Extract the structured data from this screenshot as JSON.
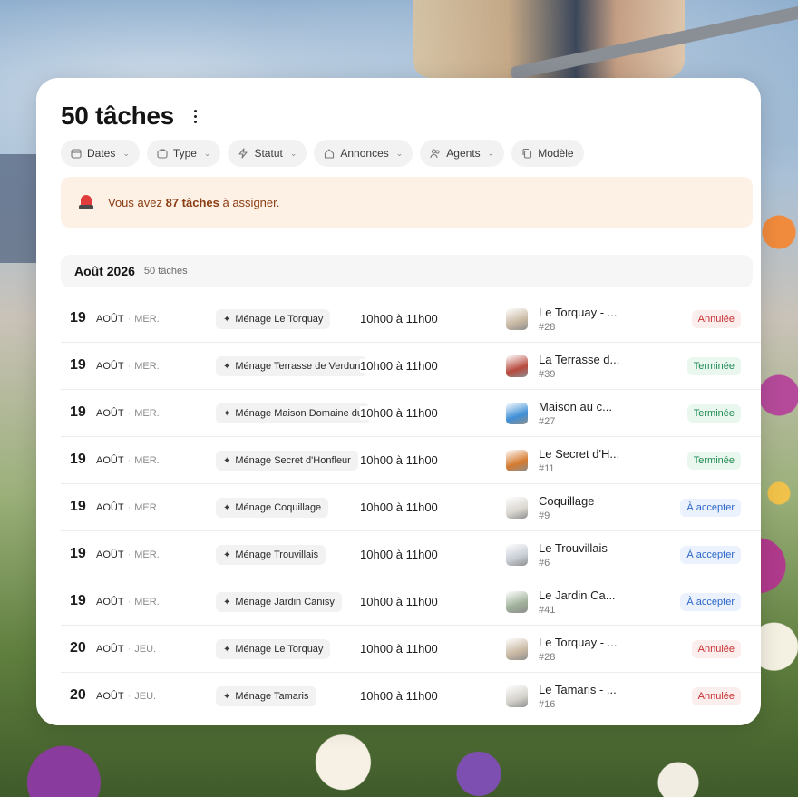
{
  "header": {
    "title": "50 tâches",
    "menu_icon": "kebab-icon"
  },
  "filters": [
    {
      "label": "Dates",
      "icon": "calendar-icon"
    },
    {
      "label": "Type",
      "icon": "briefcase-icon"
    },
    {
      "label": "Statut",
      "icon": "bolt-icon"
    },
    {
      "label": "Annonces",
      "icon": "home-icon"
    },
    {
      "label": "Agents",
      "icon": "users-icon"
    },
    {
      "label": "Modèle",
      "icon": "copy-icon"
    }
  ],
  "alert": {
    "prefix": "Vous avez ",
    "count": "87 tâches",
    "suffix": " à assigner.",
    "icon": "siren-icon"
  },
  "month": {
    "name": "Août 2026",
    "count": "50 tâches"
  },
  "tasks": [
    {
      "day": "19",
      "month": "AOÛT",
      "weekday": "MER.",
      "name": "Ménage Le Torquay",
      "time": "10h00 à 11h00",
      "property": "Le Torquay - ...",
      "ref": "#28",
      "status": "Annulée",
      "status_type": "annulee",
      "thumb_color": "#c9b9a3"
    },
    {
      "day": "19",
      "month": "AOÛT",
      "weekday": "MER.",
      "name": "Ménage Terrasse de Verdun",
      "time": "10h00 à 11h00",
      "property": "La Terrasse d...",
      "ref": "#39",
      "status": "Terminée",
      "status_type": "terminee",
      "thumb_color": "#b84a3e"
    },
    {
      "day": "19",
      "month": "AOÛT",
      "weekday": "MER.",
      "name": "Ménage Maison Domaine du",
      "time": "10h00 à 11h00",
      "property": "Maison au c...",
      "ref": "#27",
      "status": "Terminée",
      "status_type": "terminee",
      "thumb_color": "#3f8fd6"
    },
    {
      "day": "19",
      "month": "AOÛT",
      "weekday": "MER.",
      "name": "Ménage Secret d'Honfleur",
      "time": "10h00 à 11h00",
      "property": "Le Secret d'H...",
      "ref": "#11",
      "status": "Terminée",
      "status_type": "terminee",
      "thumb_color": "#d57a2f"
    },
    {
      "day": "19",
      "month": "AOÛT",
      "weekday": "MER.",
      "name": "Ménage Coquillage",
      "time": "10h00 à 11h00",
      "property": "Coquillage",
      "ref": "#9",
      "status": "À accepter",
      "status_type": "accepter",
      "thumb_color": "#d9d6cf"
    },
    {
      "day": "19",
      "month": "AOÛT",
      "weekday": "MER.",
      "name": "Ménage Trouvillais",
      "time": "10h00 à 11h00",
      "property": "Le Trouvillais",
      "ref": "#6",
      "status": "À accepter",
      "status_type": "accepter",
      "thumb_color": "#c7ccd4"
    },
    {
      "day": "19",
      "month": "AOÛT",
      "weekday": "MER.",
      "name": "Ménage Jardin Canisy",
      "time": "10h00 à 11h00",
      "property": "Le Jardin Ca...",
      "ref": "#41",
      "status": "À accepter",
      "status_type": "accepter",
      "thumb_color": "#9fb09a"
    },
    {
      "day": "20",
      "month": "AOÛT",
      "weekday": "JEU.",
      "name": "Ménage Le Torquay",
      "time": "10h00 à 11h00",
      "property": "Le Torquay - ...",
      "ref": "#28",
      "status": "Annulée",
      "status_type": "annulee",
      "thumb_color": "#c9b9a3"
    },
    {
      "day": "20",
      "month": "AOÛT",
      "weekday": "JEU.",
      "name": "Ménage Tamaris",
      "time": "10h00 à 11h00",
      "property": "Le Tamaris - ...",
      "ref": "#16",
      "status": "Annulée",
      "status_type": "annulee",
      "thumb_color": "#d4d1cb"
    }
  ]
}
